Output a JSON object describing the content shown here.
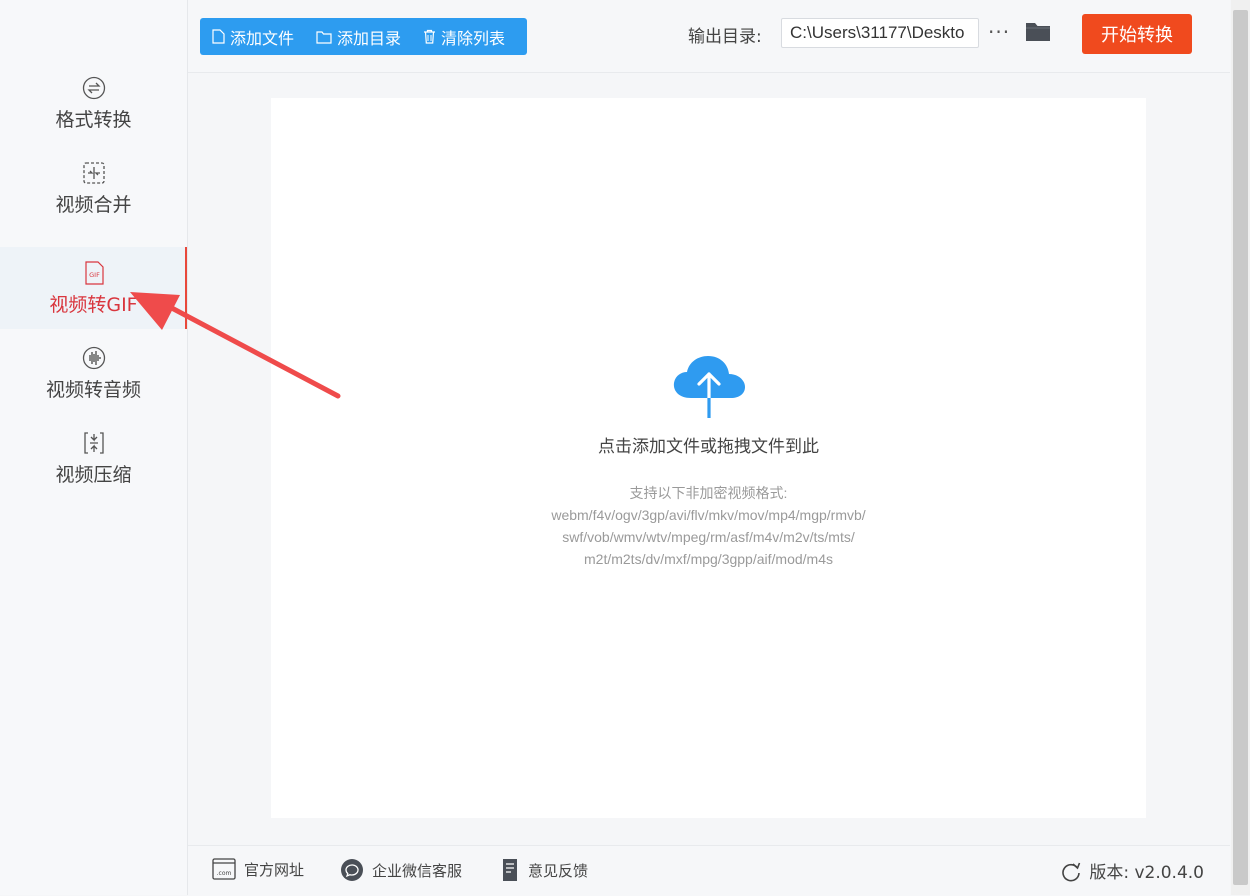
{
  "sidebar": {
    "items": [
      {
        "label": "格式转换",
        "icon": "format-convert-icon"
      },
      {
        "label": "视频合并",
        "icon": "video-merge-icon"
      },
      {
        "label": "视频转GIF",
        "icon": "gif-file-icon",
        "active": true
      },
      {
        "label": "视频转音频",
        "icon": "audio-wave-icon"
      },
      {
        "label": "视频压缩",
        "icon": "compress-icon"
      }
    ]
  },
  "toolbar": {
    "add_file": "添加文件",
    "add_folder": "添加目录",
    "clear_list": "清除列表"
  },
  "output": {
    "label": "输出目录:",
    "path": "C:\\Users\\31177\\Deskto",
    "more": "···"
  },
  "start_button": "开始转换",
  "dropzone": {
    "title": "点击添加文件或拖拽文件到此",
    "formats_heading": "支持以下非加密视频格式:",
    "formats_lines": [
      "webm/f4v/ogv/3gp/avi/flv/mkv/mov/mp4/mgp/rmvb/",
      "swf/vob/wmv/wtv/mpeg/rm/asf/m4v/m2v/ts/mts/",
      "m2t/m2ts/dv/mxf/mpg/3gpp/aif/mod/m4s"
    ]
  },
  "footer": {
    "website": "官方网址",
    "wechat": "企业微信客服",
    "feedback": "意见反馈",
    "version": "版本: v2.0.4.0"
  },
  "colors": {
    "accent_blue": "#2d9cf0",
    "start_orange": "#f04a1e",
    "active_red": "#d9363e",
    "annotation_arrow": "#ef4b4b"
  }
}
